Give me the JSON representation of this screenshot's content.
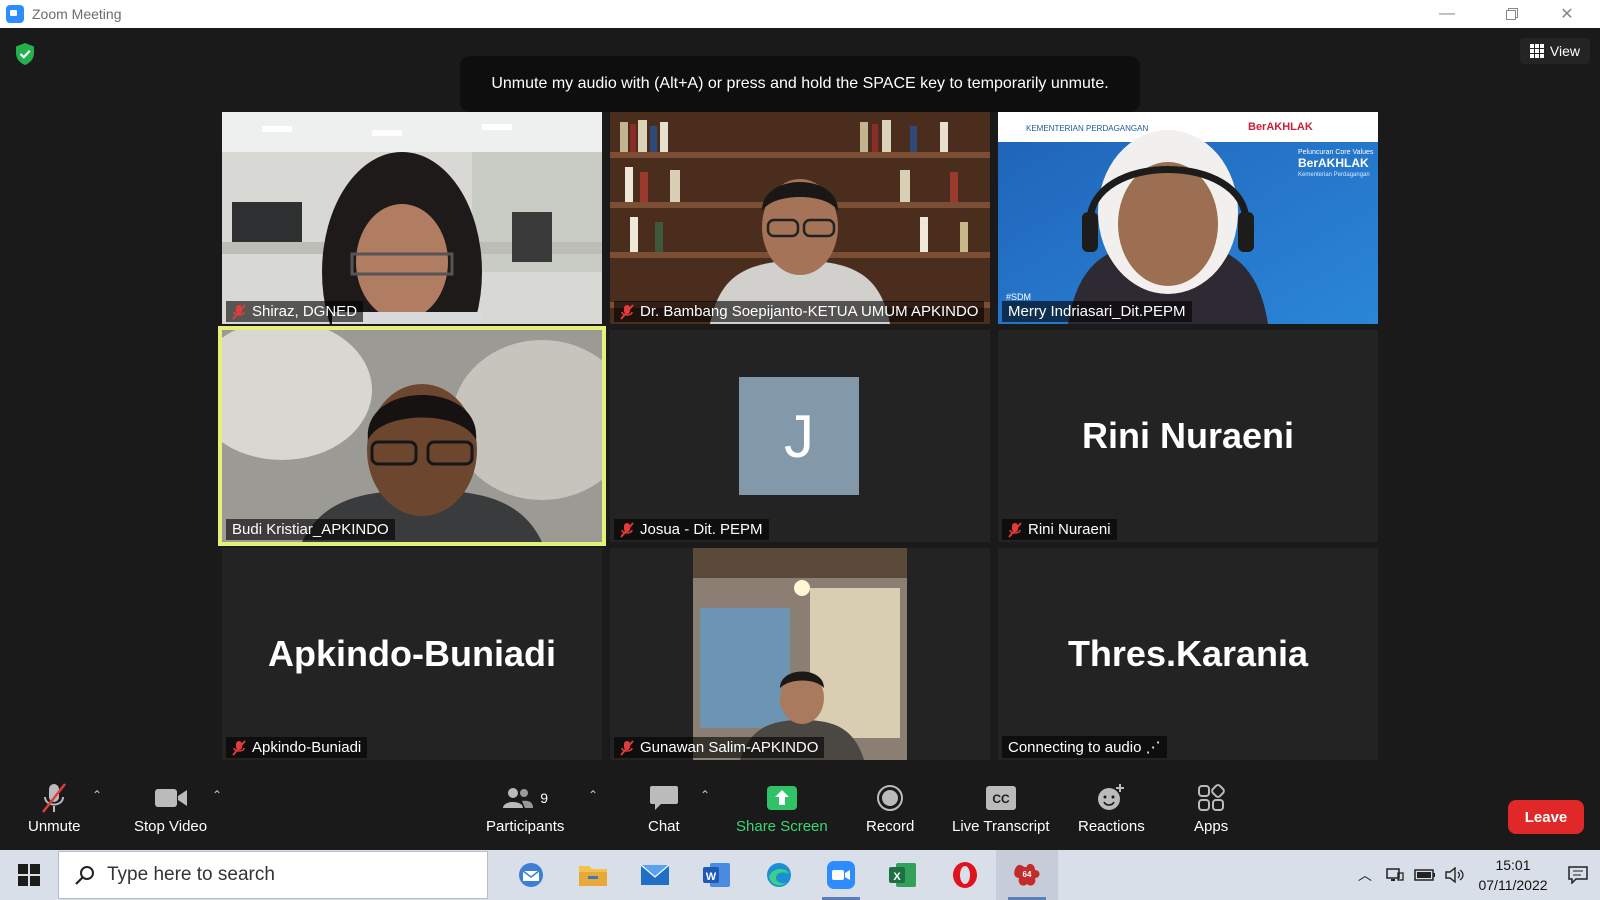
{
  "window": {
    "title": "Zoom Meeting"
  },
  "view_label": "View",
  "notice": "Unmute my audio with (Alt+A) or press and hold the SPACE key to temporarily unmute.",
  "tiles": [
    {
      "name": "Shiraz, DGNED",
      "muted": true
    },
    {
      "name": "Dr. Bambang Soepijanto-KETUA UMUM APKINDO",
      "muted": true
    },
    {
      "name": "Merry Indriasari_Dit.PEPM",
      "muted": false
    },
    {
      "name": "Budi Kristiar_APKINDO",
      "muted": false,
      "active_speaker": true
    },
    {
      "name": "Josua - Dit. PEPM",
      "muted": true,
      "avatar_letter": "J"
    },
    {
      "name": "Rini Nuraeni",
      "muted": true,
      "display_name": "Rini Nuraeni"
    },
    {
      "name": "Apkindo-Buniadi",
      "muted": true,
      "display_name": "Apkindo-Buniadi"
    },
    {
      "name": "Gunawan Salim-APKINDO",
      "muted": true
    },
    {
      "name": "Connecting to audio ⋰",
      "muted": false,
      "display_name": "Thres.Karania"
    }
  ],
  "tile_images": {
    "merry_banner_left": "KEMENTERIAN PERDAGANGAN",
    "merry_banner_right": "BerAKHLAK",
    "merry_banner_sub": "Peluncuran Core Values",
    "merry_banner_title": "BerAKHLAK",
    "merry_banner_caption": "Kementerian Perdagangan",
    "merry_tag": "#SDM"
  },
  "toolbar": {
    "unmute": "Unmute",
    "stop_video": "Stop Video",
    "participants": "Participants",
    "participants_count": "9",
    "chat": "Chat",
    "share_screen": "Share Screen",
    "record": "Record",
    "live_transcript": "Live Transcript",
    "cc": "CC",
    "reactions": "Reactions",
    "apps": "Apps",
    "leave": "Leave"
  },
  "taskbar": {
    "search_placeholder": "Type here to search",
    "time": "15:01",
    "date": "07/11/2022",
    "zoom_badge": "64"
  },
  "colors": {
    "active_speaker_border": "#e4f07a",
    "leave": "#e02828",
    "share_green": "#3bd671",
    "avatar_bg": "#8398a8"
  }
}
